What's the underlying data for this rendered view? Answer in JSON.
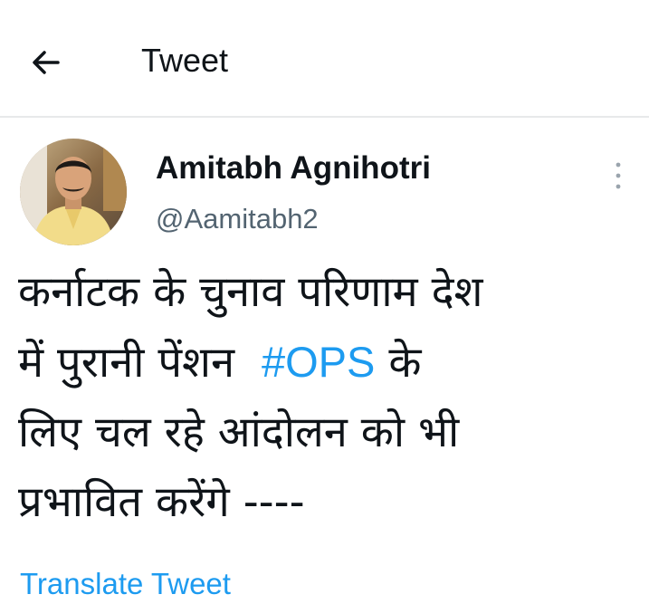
{
  "header": {
    "back_icon": "arrow-left-icon",
    "title": "Tweet"
  },
  "tweet": {
    "author": {
      "display_name": "Amitabh Agnihotri",
      "handle": "@Aamitabh2",
      "avatar_icon": "profile-photo"
    },
    "more_icon": "more-vertical-icon",
    "text": {
      "line1": "कर्नाटक के चुनाव परिणाम देश",
      "line2_before": "में पुरानी पेंशन",
      "hashtag": "#OPS",
      "line2_after": "के",
      "line3": "लिए चल रहे आंदोलन को भी",
      "line4": "प्रभावित करेंगे ----"
    },
    "translate_label": "Translate Tweet"
  },
  "colors": {
    "link": "#1d9bf0",
    "text": "#0f1419",
    "secondary": "#536471",
    "divider": "#e7e9ea"
  }
}
